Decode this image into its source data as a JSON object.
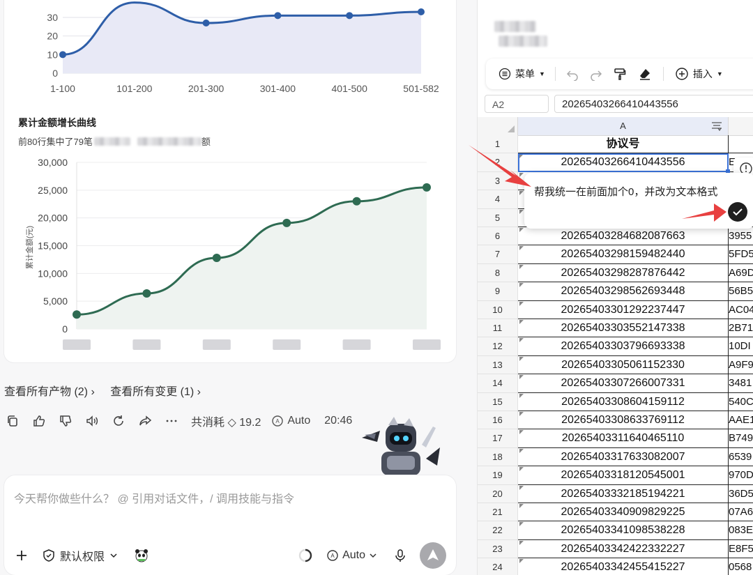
{
  "chart1": {
    "type": "line",
    "y_ticks": [
      "30",
      "20",
      "10",
      "0"
    ],
    "categories": [
      "1-100",
      "101-200",
      "201-300",
      "301-400",
      "401-500",
      "501-582"
    ],
    "values": [
      10,
      38,
      27,
      31,
      31,
      33
    ],
    "ylim": [
      0,
      35
    ],
    "line_color": "#2e5ea8",
    "fill_color": "#e8e9f6"
  },
  "chart2": {
    "title": "累计金额增长曲线",
    "subtitle_prefix": "前80行集中了79笔",
    "subtitle_suffix": "额",
    "ylabel": "累计金额(元)",
    "y_ticks": [
      "30,000",
      "25,000",
      "20,000",
      "15,000",
      "10,000",
      "5,000",
      "0"
    ],
    "values": [
      2600,
      6400,
      12800,
      19100,
      23000,
      25500
    ],
    "ylim": [
      0,
      30000
    ],
    "line_color": "#2e6b52",
    "fill_color": "#eef3f0"
  },
  "chart_data": [
    {
      "type": "line",
      "categories": [
        "1-100",
        "101-200",
        "201-300",
        "301-400",
        "401-500",
        "501-582"
      ],
      "values": [
        10,
        38,
        27,
        31,
        31,
        33
      ],
      "ylim": [
        0,
        35
      ]
    },
    {
      "type": "area",
      "title": "累计金额增长曲线",
      "ylabel": "累计金额(元)",
      "values": [
        2600,
        6400,
        12800,
        19100,
        23000,
        25500
      ],
      "ylim": [
        0,
        30000
      ]
    }
  ],
  "links": {
    "artifacts": "查看所有产物 (2) ›",
    "changes": "查看所有变更 (1) ›"
  },
  "actions": {
    "cost": "共消耗 ◇ 19.2",
    "model": "Auto",
    "time": "20:46"
  },
  "composer": {
    "placeholder": "今天帮你做些什么？ @ 引用对话文件，/ 调用技能与指令",
    "permission": "默认权限",
    "model": "Auto"
  },
  "sheet": {
    "menu_label": "菜单",
    "insert_label": "插入",
    "cell_ref": "A2",
    "formula_value": "20265403266410443556",
    "col_a": "A",
    "rows": [
      {
        "n": "1",
        "a": "协议号",
        "b": ""
      },
      {
        "n": "2",
        "a": "20265403266410443556",
        "b": "E"
      },
      {
        "n": "3",
        "a": "",
        "b": ""
      },
      {
        "n": "4",
        "a": "",
        "b": ""
      },
      {
        "n": "5",
        "a": "",
        "b": ""
      },
      {
        "n": "6",
        "a": "20265403284682087663",
        "b": "3955"
      },
      {
        "n": "7",
        "a": "20265403298159482440",
        "b": "5FD5"
      },
      {
        "n": "8",
        "a": "20265403298287876442",
        "b": "A69D"
      },
      {
        "n": "9",
        "a": "20265403298562693448",
        "b": "56B5"
      },
      {
        "n": "10",
        "a": "20265403301292237447",
        "b": "AC04"
      },
      {
        "n": "11",
        "a": "20265403303552147338",
        "b": "2B71"
      },
      {
        "n": "12",
        "a": "20265403303796693338",
        "b": "10DI"
      },
      {
        "n": "13",
        "a": "20265403305061152330",
        "b": "A9F9"
      },
      {
        "n": "14",
        "a": "20265403307266007331",
        "b": "3481"
      },
      {
        "n": "15",
        "a": "20265403308604159112",
        "b": "540C"
      },
      {
        "n": "16",
        "a": "20265403308633769112",
        "b": "AAE1"
      },
      {
        "n": "17",
        "a": "20265403311640465110",
        "b": "B749"
      },
      {
        "n": "18",
        "a": "20265403317633082007",
        "b": "6539"
      },
      {
        "n": "19",
        "a": "20265403318120545001",
        "b": "970D"
      },
      {
        "n": "20",
        "a": "20265403332185194221",
        "b": "36D5"
      },
      {
        "n": "21",
        "a": "20265403340909829225",
        "b": "07A6"
      },
      {
        "n": "22",
        "a": "20265403341098538228",
        "b": "083E"
      },
      {
        "n": "23",
        "a": "20265403342422332227",
        "b": "E8F5"
      },
      {
        "n": "24",
        "a": "20265403342455415227",
        "b": "0568"
      }
    ]
  },
  "prompt_popup": {
    "text": "帮我统一在前面加个0，并改为文本格式"
  },
  "colors": {
    "annotation_arrow": "#e84040",
    "selection": "#3b73d9"
  }
}
